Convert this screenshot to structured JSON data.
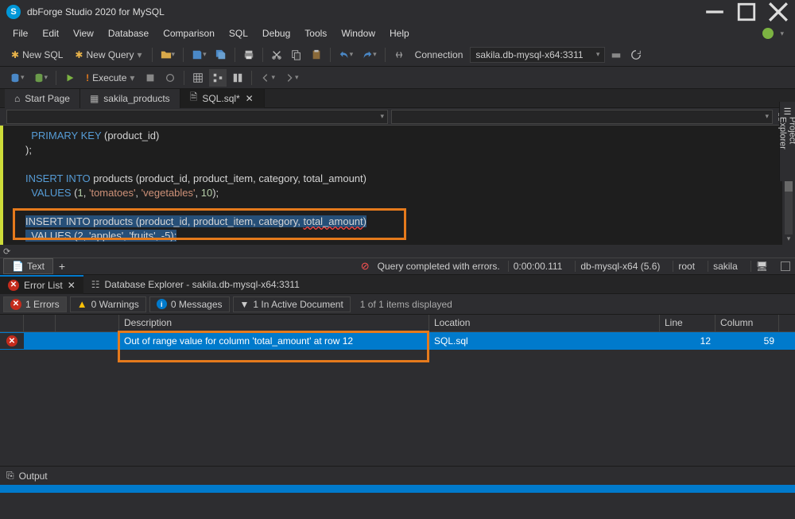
{
  "title": "dbForge Studio 2020 for MySQL",
  "menu": [
    "File",
    "Edit",
    "View",
    "Database",
    "Comparison",
    "SQL",
    "Debug",
    "Tools",
    "Window",
    "Help"
  ],
  "toolbar": {
    "new_sql": "New SQL",
    "new_query": "New Query",
    "execute": "Execute",
    "connection_label": "Connection",
    "connection_value": "sakila.db-mysql-x64:3311"
  },
  "tabs": {
    "start": "Start Page",
    "sakila": "sakila_products",
    "sql": "SQL.sql*"
  },
  "code": {
    "l1a": "PRIMARY KEY",
    "l1b": " (product_id)",
    "l2": ");",
    "l3a": "INSERT INTO",
    "l3b": " products (product_id, product_item, category, total_amount)",
    "l4a": "  VALUES",
    "l4b": " (",
    "l4c": "1",
    "l4d": ", ",
    "l4e": "'tomatoes'",
    "l4f": ", ",
    "l4g": "'vegetables'",
    "l4h": ", ",
    "l4i": "10",
    "l4j": ");",
    "l5a": "INSERT INTO",
    "l5b": " products (product_id, product_item, category, ",
    "l5c": "total_amount",
    "l5d": ")",
    "l6a": "  VALUES (2, 'apples', 'fruits', -5);"
  },
  "texttab": "Text",
  "status": {
    "msg": "Query completed with errors.",
    "time": "0:00:00.111",
    "server": "db-mysql-x64 (5.6)",
    "user": "root",
    "db": "sakila"
  },
  "bottom_tabs": {
    "error_list": "Error List",
    "db_explorer": "Database Explorer - sakila.db-mysql-x64:3311"
  },
  "filters": {
    "errors": "1 Errors",
    "warnings": "0 Warnings",
    "messages": "0 Messages",
    "active": "1 In Active Document",
    "displayed": "1 of 1 items displayed"
  },
  "grid": {
    "headers": {
      "desc": "Description",
      "loc": "Location",
      "line": "Line",
      "col": "Column"
    },
    "row": {
      "desc": "Out of range value for column 'total_amount' at row 12",
      "loc": "SQL.sql",
      "line": "12",
      "col": "59"
    }
  },
  "output": "Output",
  "right_panel": "Project Explorer"
}
